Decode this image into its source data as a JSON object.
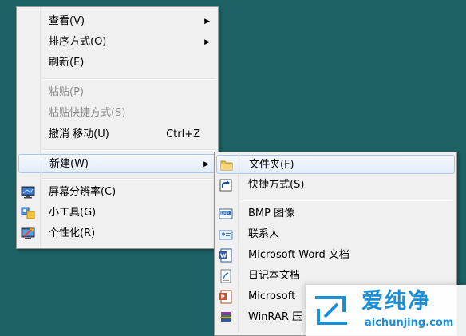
{
  "context_menu": {
    "items": [
      {
        "label": "查看(V)",
        "has_submenu": true
      },
      {
        "label": "排序方式(O)",
        "has_submenu": true
      },
      {
        "label": "刷新(E)"
      },
      {
        "label": "粘贴(P)",
        "disabled": true
      },
      {
        "label": "粘贴快捷方式(S)",
        "disabled": true
      },
      {
        "label": "撤消 移动(U)",
        "shortcut": "Ctrl+Z"
      },
      {
        "label": "新建(W)",
        "has_submenu": true,
        "highlighted": true
      },
      {
        "label": "屏幕分辨率(C)",
        "icon": "display-icon"
      },
      {
        "label": "小工具(G)",
        "icon": "gadgets-icon"
      },
      {
        "label": "个性化(R)",
        "icon": "personalize-icon"
      }
    ]
  },
  "new_submenu": {
    "items": [
      {
        "label": "文件夹(F)",
        "icon": "folder-icon",
        "highlighted": true
      },
      {
        "label": "快捷方式(S)",
        "icon": "shortcut-icon"
      },
      {
        "label": "BMP 图像",
        "icon": "bmp-icon"
      },
      {
        "label": "联系人",
        "icon": "contact-icon"
      },
      {
        "label": "Microsoft Word 文档",
        "icon": "word-icon"
      },
      {
        "label": "日记本文档",
        "icon": "journal-icon"
      },
      {
        "label": "Microsoft",
        "icon": "office-icon"
      },
      {
        "label": "WinRAR 压",
        "icon": "winrar-icon"
      }
    ]
  },
  "watermark": {
    "title": "爱纯净",
    "url": "aichunjing.com"
  },
  "colors": {
    "desktop": "#1e6265",
    "menu_bg": "#f0f0f0",
    "highlight_border": "#a8c9ee",
    "watermark_blue": "#1a8fd8"
  }
}
